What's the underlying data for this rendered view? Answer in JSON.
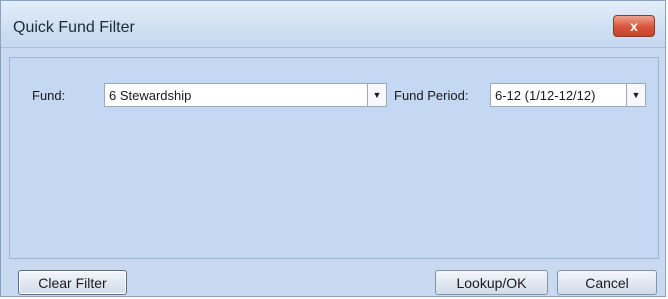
{
  "window": {
    "title": "Quick Fund Filter",
    "close_label": "x"
  },
  "filters": {
    "fund_label": "Fund:",
    "fund_value": "6 Stewardship",
    "fund_period_label": "Fund Period:",
    "fund_period_value": "6-12 (1/12-12/12)"
  },
  "buttons": {
    "clear_filter": "Clear Filter",
    "lookup_ok": "Lookup/OK",
    "cancel": "Cancel"
  },
  "icons": {
    "dropdown": "chevron-down-icon",
    "close": "close-icon"
  },
  "colors": {
    "window_bg": "#c9daf0",
    "close_button": "#d6553a"
  }
}
